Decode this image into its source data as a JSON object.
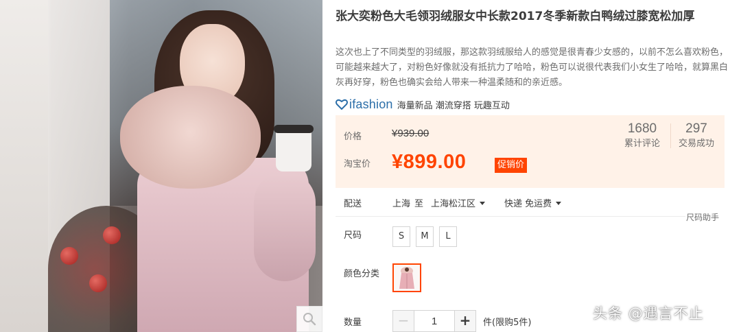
{
  "product": {
    "title": "张大奕粉色大毛领羽绒服女中长款2017冬季新款白鸭绒过膝宽松加厚",
    "subtitle": "这次也上了不同类型的羽绒服，那这款羽绒服给人的感觉是很青春少女感的，以前不怎么喜欢粉色，可能越来越大了，对粉色好像就没有抵抗力了哈哈，粉色可以说很代表我们小女生了哈哈，就算黑白灰再好穿，粉色也确实会给人带来一种温柔随和的亲近感。"
  },
  "brand": {
    "logo_text": "ifashion",
    "tags": "海量新品 潮流穿搭 玩趣互动"
  },
  "price": {
    "original_label": "价格",
    "original": "¥939.00",
    "taobao_label": "淘宝价",
    "sale": "¥899.00",
    "promo": "促销价"
  },
  "stats": [
    {
      "value": "1680",
      "label": "累计评论"
    },
    {
      "value": "297",
      "label": "交易成功"
    }
  ],
  "shipping": {
    "label": "配送",
    "from": "上海",
    "to_word": "至",
    "destination": "上海松江区",
    "method": "快递",
    "fee": "免运费"
  },
  "size_helper": "尺码助手",
  "size": {
    "label": "尺码",
    "options": [
      "S",
      "M",
      "L"
    ]
  },
  "color": {
    "label": "颜色分类"
  },
  "quantity": {
    "label": "数量",
    "minus": "−",
    "value": "1",
    "plus": "+",
    "unit": "件(限购5件)"
  },
  "watermark": "头条 @遇言不止",
  "colors": {
    "accent": "#ff4400",
    "price_bg": "#fff2e8",
    "brand": "#2b6ea8"
  },
  "icons": {
    "zoom": "magnifier-icon",
    "brand": "ifashion-heart-icon",
    "caret": "caret-down-icon"
  }
}
